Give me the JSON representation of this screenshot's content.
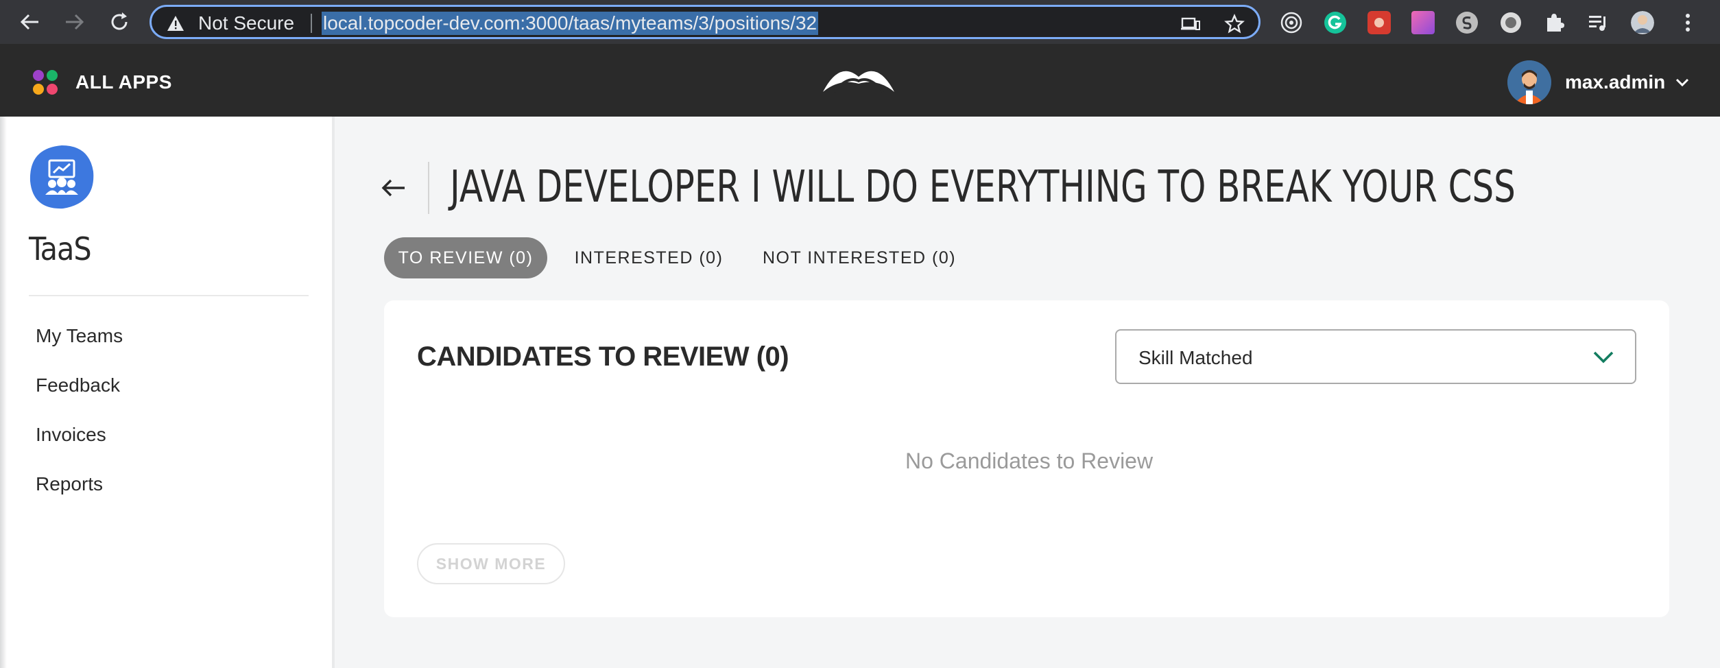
{
  "browser": {
    "security_status": "Not Secure",
    "url": "local.topcoder-dev.com:3000/taas/myteams/3/positions/32"
  },
  "header": {
    "all_apps_label": "ALL APPS",
    "user_name": "max.admin"
  },
  "sidebar": {
    "app_name": "TaaS",
    "items": [
      {
        "label": "My Teams"
      },
      {
        "label": "Feedback"
      },
      {
        "label": "Invoices"
      },
      {
        "label": "Reports"
      }
    ]
  },
  "main": {
    "title": "JAVA DEVELOPER I WILL DO EVERYTHING TO BREAK YOUR CSS",
    "tabs": [
      {
        "label": "TO REVIEW (0)",
        "active": true
      },
      {
        "label": "INTERESTED (0)",
        "active": false
      },
      {
        "label": "NOT INTERESTED (0)",
        "active": false
      }
    ],
    "card": {
      "title": "CANDIDATES TO REVIEW (0)",
      "sort_select": "Skill Matched",
      "empty_message": "No Candidates to Review",
      "show_more_label": "SHOW MORE"
    }
  },
  "colors": {
    "accent_green": "#137d60",
    "header_bg": "#2a2a2a",
    "active_tab": "#7f7f7f"
  }
}
